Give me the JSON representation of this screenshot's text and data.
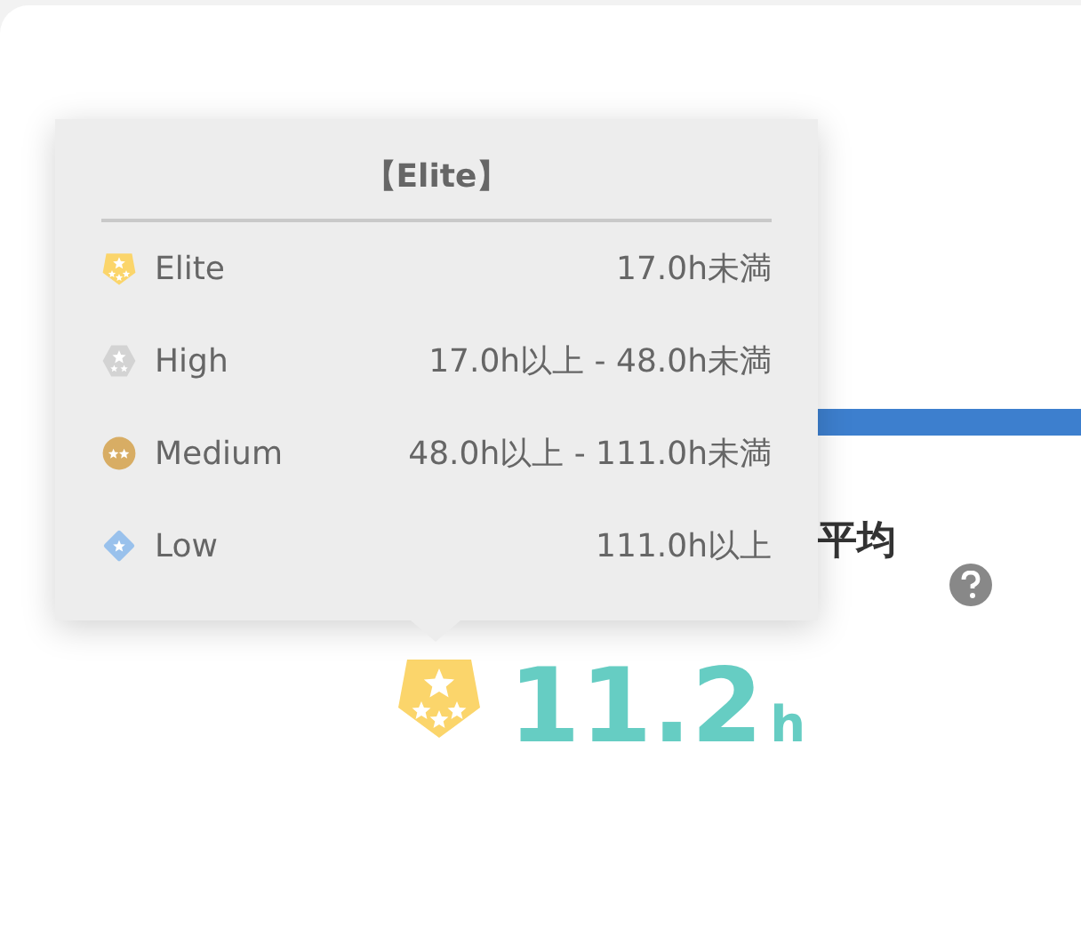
{
  "card": {
    "subheading": "平均",
    "result": {
      "value": "11.2",
      "unit": "h",
      "kind": "pentagon",
      "color": "#fbd56b"
    }
  },
  "tooltip": {
    "title": "【Elite】",
    "levels": [
      {
        "name": "Elite",
        "range": "17.0h未満",
        "kind": "pentagon",
        "color": "#fbd56b"
      },
      {
        "name": "High",
        "range": "17.0h以上 - 48.0h未満",
        "kind": "hexagon",
        "color": "#d3d3d3"
      },
      {
        "name": "Medium",
        "range": "48.0h以上 - 111.0h未満",
        "kind": "circle",
        "color": "#d8ad64"
      },
      {
        "name": "Low",
        "range": "111.0h以上",
        "kind": "diamond",
        "color": "#99c1ec"
      }
    ]
  }
}
